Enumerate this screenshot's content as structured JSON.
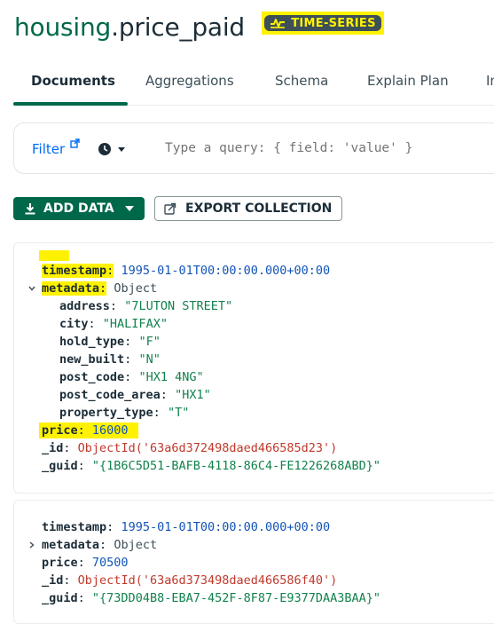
{
  "header": {
    "database": "housing",
    "separator": ".",
    "collection": "price_paid",
    "badge": "TIME-SERIES"
  },
  "tabs": [
    {
      "label": "Documents",
      "active": true
    },
    {
      "label": "Aggregations"
    },
    {
      "label": "Schema"
    },
    {
      "label": "Explain Plan"
    },
    {
      "label": "In"
    }
  ],
  "filter": {
    "label": "Filter",
    "placeholder": "Type a query: { field: 'value' }"
  },
  "toolbar": {
    "add_data": "ADD DATA",
    "export": "EXPORT COLLECTION"
  },
  "documents": [
    {
      "expanded": true,
      "fields": {
        "timestamp": {
          "key": "timestamp",
          "value": "1995-01-01T00:00:00.000+00:00"
        },
        "metadata": {
          "key": "metadata",
          "value": "Object"
        },
        "address": {
          "key": "address",
          "value": "\"7LUTON STREET\""
        },
        "city": {
          "key": "city",
          "value": "\"HALIFAX\""
        },
        "hold_type": {
          "key": "hold_type",
          "value": "\"F\""
        },
        "new_built": {
          "key": "new_built",
          "value": "\"N\""
        },
        "post_code": {
          "key": "post_code",
          "value": "\"HX1 4NG\""
        },
        "post_code_area": {
          "key": "post_code_area",
          "value": "\"HX1\""
        },
        "property_type": {
          "key": "property_type",
          "value": "\"T\""
        },
        "price": {
          "key": "price",
          "value": "16000"
        },
        "id": {
          "key": "_id",
          "value": "ObjectId('63a6d372498daed466585d23')"
        },
        "guid": {
          "key": "_guid",
          "value": "\"{1B6C5D51-BAFB-4118-86C4-FE1226268ABD}\""
        }
      }
    },
    {
      "expanded": false,
      "fields": {
        "timestamp": {
          "key": "timestamp",
          "value": "1995-01-01T00:00:00.000+00:00"
        },
        "metadata": {
          "key": "metadata",
          "value": "Object"
        },
        "price": {
          "key": "price",
          "value": "70500"
        },
        "id": {
          "key": "_id",
          "value": "ObjectId('63a6d373498daed466586f40')"
        },
        "guid": {
          "key": "_guid",
          "value": "\"{73DD04B8-EBA7-452F-8F87-E9377DAA3BAA}\""
        }
      }
    }
  ],
  "colors": {
    "accent": "#00684a",
    "highlight": "#fff200",
    "link": "#016bf8"
  }
}
